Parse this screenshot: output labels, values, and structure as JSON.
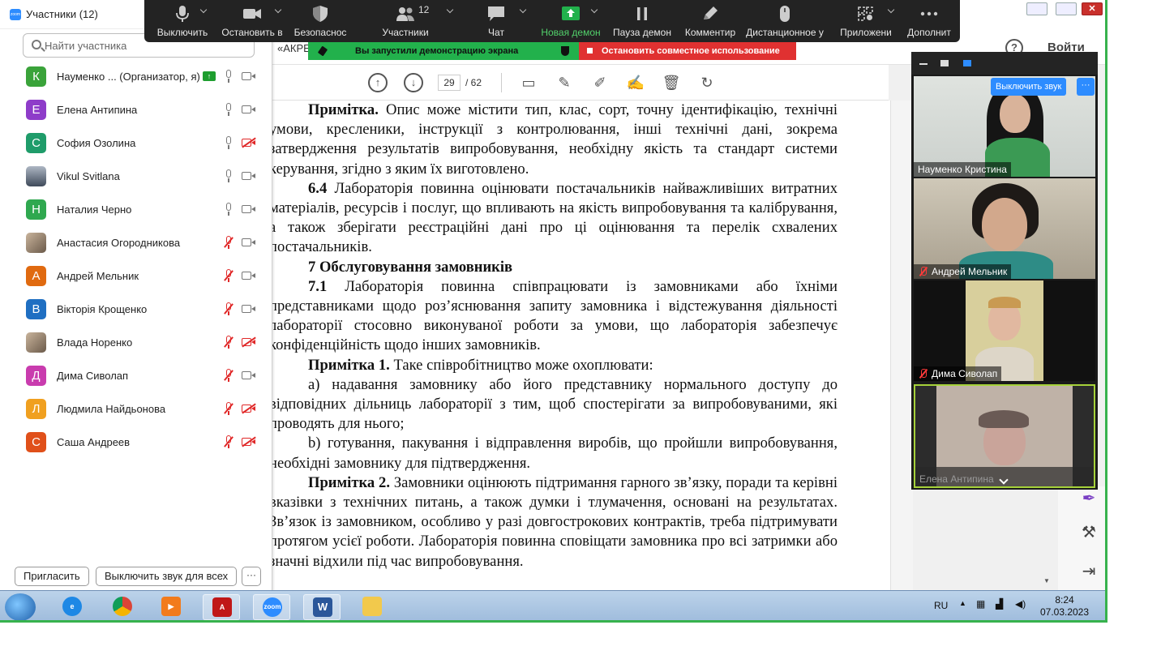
{
  "control_bar": {
    "mute": "Выключить",
    "stop_video": "Остановить в",
    "security": "Безопаснос",
    "participants": "Участники",
    "participants_count": "12",
    "chat": "Чат",
    "new_share": "Новая демон",
    "pause_share": "Пауза демон",
    "annotate": "Комментир",
    "remote_control": "Дистанционное у",
    "apps": "Приложени",
    "more": "Дополнит"
  },
  "banner": {
    "sharing": "Вы запустили демонстрацию экрана",
    "stop": "Остановить совместное использование"
  },
  "participants_panel": {
    "title": "Участники (12)",
    "search_placeholder": "Найти участника",
    "invite": "Пригласить",
    "mute_all": "Выключить звук для всех",
    "more": "···",
    "items": [
      {
        "initial": "К",
        "name": "Науменко ... (Организатор, я)",
        "color": "#3aa33a",
        "mic": "on",
        "cam": "on",
        "sharing": true
      },
      {
        "initial": "Е",
        "name": "Елена Антипина",
        "color": "#8e3cc9",
        "mic": "on",
        "cam": "on"
      },
      {
        "initial": "С",
        "name": "София Озолина",
        "color": "#1f9c6a",
        "mic": "on",
        "cam": "off"
      },
      {
        "initial": "",
        "name": "Vikul Svitlana",
        "color": "#5a6a80",
        "photo": true,
        "mic": "on",
        "cam": "on"
      },
      {
        "initial": "Н",
        "name": "Наталия Черно",
        "color": "#2fa84f",
        "mic": "on",
        "cam": "on"
      },
      {
        "initial": "",
        "name": "Анастасия Огородникова",
        "color": "#b99",
        "photo": true,
        "mic": "muted",
        "cam": "on"
      },
      {
        "initial": "А",
        "name": "Андрей Мельник",
        "color": "#e06a10",
        "mic": "muted",
        "cam": "on"
      },
      {
        "initial": "В",
        "name": "Вікторія Крощенко",
        "color": "#1f6fc2",
        "mic": "muted",
        "cam": "on"
      },
      {
        "initial": "",
        "name": "Влада Норенко",
        "color": "#a88",
        "photo": true,
        "mic": "muted",
        "cam": "off"
      },
      {
        "initial": "Д",
        "name": "Дима Сиволап",
        "color": "#c93cae",
        "mic": "muted",
        "cam": "on"
      },
      {
        "initial": "Л",
        "name": "Людмила Найдьонова",
        "color": "#f0a020",
        "mic": "muted",
        "cam": "off"
      },
      {
        "initial": "С",
        "name": "Саша Андреев",
        "color": "#e0501a",
        "mic": "muted",
        "cam": "off"
      }
    ]
  },
  "document": {
    "tab": "«АКРЕ",
    "help": "?",
    "signin": "Войти",
    "page_current": "29",
    "page_total": "/ 62",
    "paragraphs": [
      {
        "lead": "Примітка.",
        "text": " Опис може містити тип, клас, сорт, точну ідентифікацію, технічні умови, кресленики, інструкції з контролювання, інші технічні дані, зокрема затвердження результатів випробовування, необхідну якість та стандарт системи керування, згідно з яким їх виготовлено."
      },
      {
        "lead": "6.4",
        "text": " Лабораторія повинна оцінювати постачальників найважливіших витратних матеріалів, ресурсів і послуг, що впливають на якість випробовування та калібрування, а також зберігати реєстраційні дані про ці оцінювання та перелік схвалених постачальників."
      },
      {
        "lead": "7 Обслуговування замовників",
        "text": ""
      },
      {
        "lead": "7.1",
        "text": " Лабораторія повинна співпрацювати із замовниками або їхніми представниками щодо роз’яснювання запиту замовника і відстежування діяльності лабораторії стосовно виконуваної роботи за умови, що лабораторія забезпечує конфіденційність щодо інших замовників."
      },
      {
        "lead": "Примітка 1.",
        "text": " Таке співробітництво може охоплювати:"
      },
      {
        "lead": "",
        "text": "a) надавання замовнику або його представнику нормального доступу до відповідних дільниць лабораторії з тим, щоб спостерігати за випробовуваними, які проводять для нього;"
      },
      {
        "lead": "",
        "text": "b) готування, пакування і відправлення виробів, що пройшли випробовування, необхідні замовнику для підтвердження."
      },
      {
        "lead": "Примітка 2.",
        "text": " Замовники оцінюють підтримання гарного зв’язку, поради та керівні вказівки з технічних питань, а також думки і тлумачення, основані на результатах. Зв’язок із замовником, особливо у разі довгострокових контрактів, треба підтримувати протягом усієї роботи. Лабораторія повинна сповіщати замовника про всі затримки або значні відхили під час випробовування."
      }
    ]
  },
  "video_panel": {
    "unmute": "Выключить звук",
    "more": "···",
    "tiles": [
      {
        "name": "Науменко Кристина",
        "muted": false
      },
      {
        "name": "Андрей Мельник",
        "muted": true
      },
      {
        "name": "Дима Сиволап",
        "muted": true
      },
      {
        "name": "Елена Антипина",
        "muted": false
      }
    ]
  },
  "taskbar": {
    "lang": "RU",
    "time": "8:24",
    "date": "07.03.2023",
    "zoom_label": "zoom",
    "word_label": "W"
  }
}
